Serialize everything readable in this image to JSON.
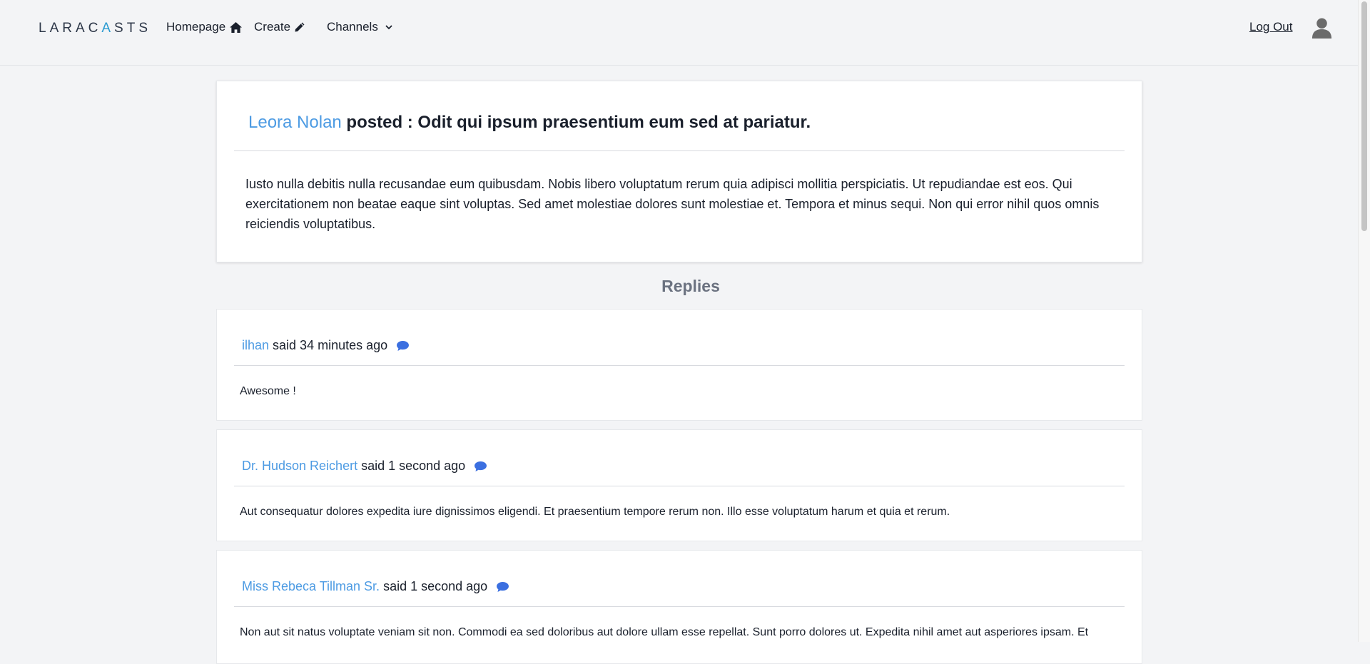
{
  "header": {
    "logo_left": "LARAC",
    "logo_accent": "A",
    "logo_right": "STS",
    "nav": [
      {
        "label": "Homepage",
        "icon": "home-icon"
      },
      {
        "label": "Create",
        "icon": "pencil-icon"
      },
      {
        "label": "Channels",
        "icon": "chevron-down-icon"
      }
    ],
    "logout_label": "Log Out",
    "avatar_icon": "user-icon"
  },
  "thread": {
    "author": "Leora Nolan",
    "title_text": " posted : Odit qui ipsum praesentium eum sed at pariatur.",
    "body": "Iusto nulla debitis nulla recusandae eum quibusdam. Nobis libero voluptatum rerum quia adipisci mollitia perspiciatis. Ut repudiandae est eos. Qui exercitationem non beatae eaque sint voluptas. Sed amet molestiae dolores sunt molestiae et. Tempora et minus sequi. Non qui error nihil quos omnis reiciendis voluptatibus."
  },
  "replies_title": "Replies",
  "replies": [
    {
      "author": "ilhan",
      "meta": "said 34 minutes ago",
      "body": "Awesome !"
    },
    {
      "author": "Dr. Hudson Reichert",
      "meta": "said 1 second ago",
      "body": "Aut consequatur dolores expedita iure dignissimos eligendi. Et praesentium tempore rerum non. Illo esse voluptatum harum et quia et rerum."
    },
    {
      "author": "Miss Rebeca Tillman Sr.",
      "meta": "said 1 second ago",
      "body": "Non aut sit natus voluptate veniam sit non. Commodi ea sed doloribus aut dolore ullam esse repellat. Sunt porro dolores ut. Expedita nihil amet aut asperiores ipsam. Et"
    }
  ],
  "colors": {
    "accent": "#4d9be3",
    "comment_icon": "#3b6fe0",
    "background": "#f3f4f6"
  }
}
